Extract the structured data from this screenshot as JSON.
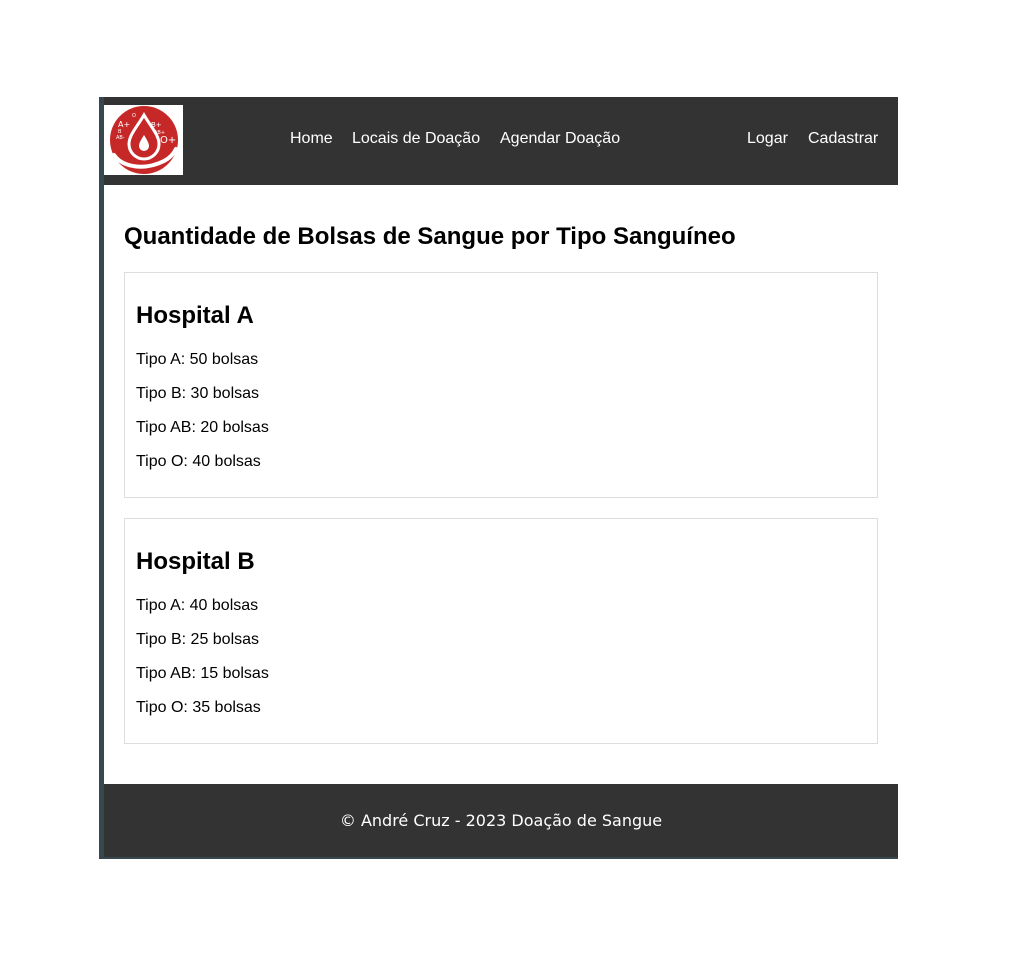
{
  "colors": {
    "navbar_bg": "#333333",
    "footer_bg": "#333333",
    "nav_text": "#ffffff",
    "frame_border": "#37474f",
    "card_border": "#dddddd",
    "logo_red": "#c62828"
  },
  "logo": {
    "icon": "blood-drop-logo",
    "labels": [
      "A+",
      "B+",
      "O+",
      "AB-",
      "AB+",
      "B",
      "O"
    ]
  },
  "nav": {
    "home": "Home",
    "locais": "Locais de Doação",
    "agendar": "Agendar Doação",
    "logar": "Logar",
    "cadastrar": "Cadastrar"
  },
  "main": {
    "title": "Quantidade de Bolsas de Sangue por Tipo Sanguíneo",
    "hospitals": [
      {
        "name": "Hospital A",
        "lines": [
          "Tipo A: 50 bolsas",
          "Tipo B: 30 bolsas",
          "Tipo AB: 20 bolsas",
          "Tipo O: 40 bolsas"
        ]
      },
      {
        "name": "Hospital B",
        "lines": [
          "Tipo A: 40 bolsas",
          "Tipo B: 25 bolsas",
          "Tipo AB: 15 bolsas",
          "Tipo O: 35 bolsas"
        ]
      }
    ]
  },
  "footer": {
    "text": "© André Cruz - 2023 Doação de Sangue"
  }
}
